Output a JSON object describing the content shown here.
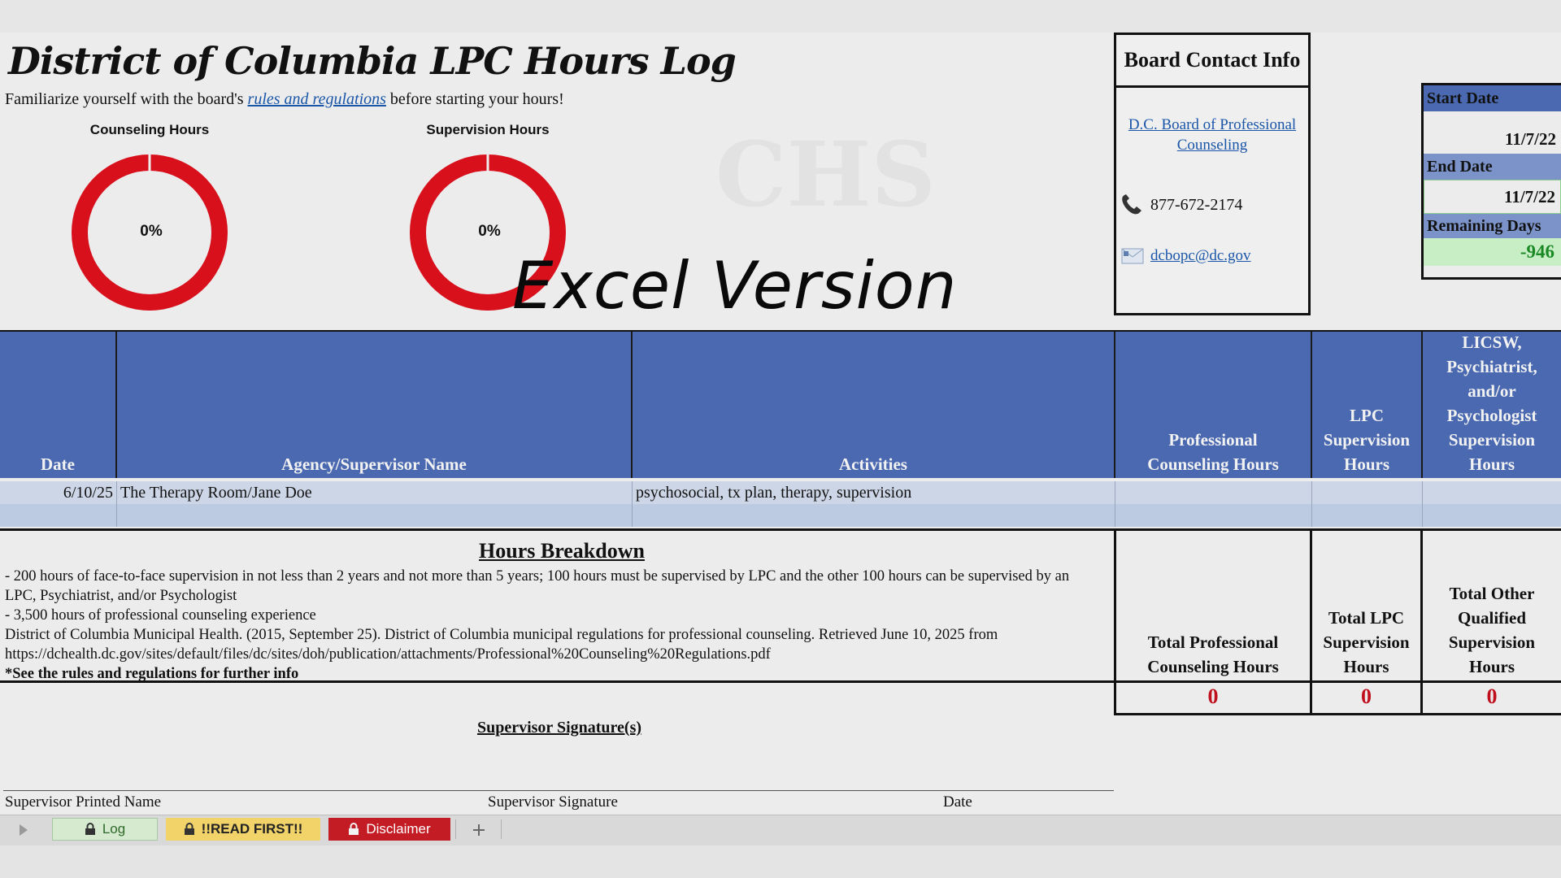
{
  "sheet": {
    "title": "District of Columbia LPC Hours Log",
    "subtitle_before": "Familiarize yourself with the board's ",
    "subtitle_link": "rules and regulations",
    "subtitle_after": " before starting your hours!",
    "watermark": "Excel Version",
    "ghost_text": "CHS"
  },
  "donuts": [
    {
      "title": "Counseling Hours",
      "percent_label": "0%",
      "percent": 0
    },
    {
      "title": "Supervision Hours",
      "percent_label": "0%",
      "percent": 0
    }
  ],
  "contact": {
    "heading": "Board Contact Info",
    "board_link": "D.C. Board of Professional Counseling",
    "phone": "877-672-2174",
    "email": "dcbopc@dc.gov"
  },
  "dates": {
    "start_label": "Start Date",
    "start_value": "11/7/22",
    "end_label": "End Date",
    "end_value": "11/7/22",
    "remaining_label": "Remaining Days",
    "remaining_value": "-946"
  },
  "table": {
    "headers": {
      "date": "Date",
      "agency": "Agency/Supervisor Name",
      "activities": "Activities",
      "pc_hours": "Professional Counseling Hours",
      "lpc_hours": "LPC Supervision Hours",
      "other_hours": "LICSW, Psychiatrist, and/or Psychologist Supervision Hours"
    },
    "rows": [
      {
        "date": "6/10/25",
        "agency": "The Therapy Room/Jane Doe",
        "activities": "psychosocial, tx plan, therapy, supervision",
        "pc": "",
        "lpc": "",
        "other": ""
      }
    ]
  },
  "breakdown": {
    "title": "Hours Breakdown",
    "line1": "- 200 hours of face-to-face supervision in not less than 2 years and not more than 5 years; 100 hours must be supervised by LPC and the other 100 hours can be supervised by an LPC, Psychiatrist, and/or Psychologist",
    "line2": "- 3,500 hours of professional counseling experience",
    "line3": "District of Columbia Municipal Health. (2015, September 25). District of Columbia municipal regulations for professional counseling. Retrieved June 10, 2025 from https://dchealth.dc.gov/sites/default/files/dc/sites/doh/publication/attachments/Professional%20Counseling%20Regulations.pdf",
    "line4": "*See the rules and regulations for further info"
  },
  "totals": {
    "pc_label": "Total Professional Counseling Hours",
    "lpc_label": "Total LPC Supervision Hours",
    "other_label": "Total Other Qualified Supervision Hours",
    "pc_value": "0",
    "lpc_value": "0",
    "other_value": "0"
  },
  "signature": {
    "title": "Supervisor Signature(s)",
    "printed_name": "Supervisor Printed Name",
    "signature": "Supervisor Signature",
    "date": "Date"
  },
  "tabs": [
    {
      "label": "Log",
      "color": "#d6ead0"
    },
    {
      "label": "!!READ FIRST!!",
      "color": "#f2d36a"
    },
    {
      "label": "Disclaimer",
      "color": "#c41c24"
    }
  ],
  "colors": {
    "header_blue": "#4a69b0",
    "donut_red": "#d8101c",
    "total_red": "#c0101e",
    "remaining_green": "#1a8a24"
  }
}
